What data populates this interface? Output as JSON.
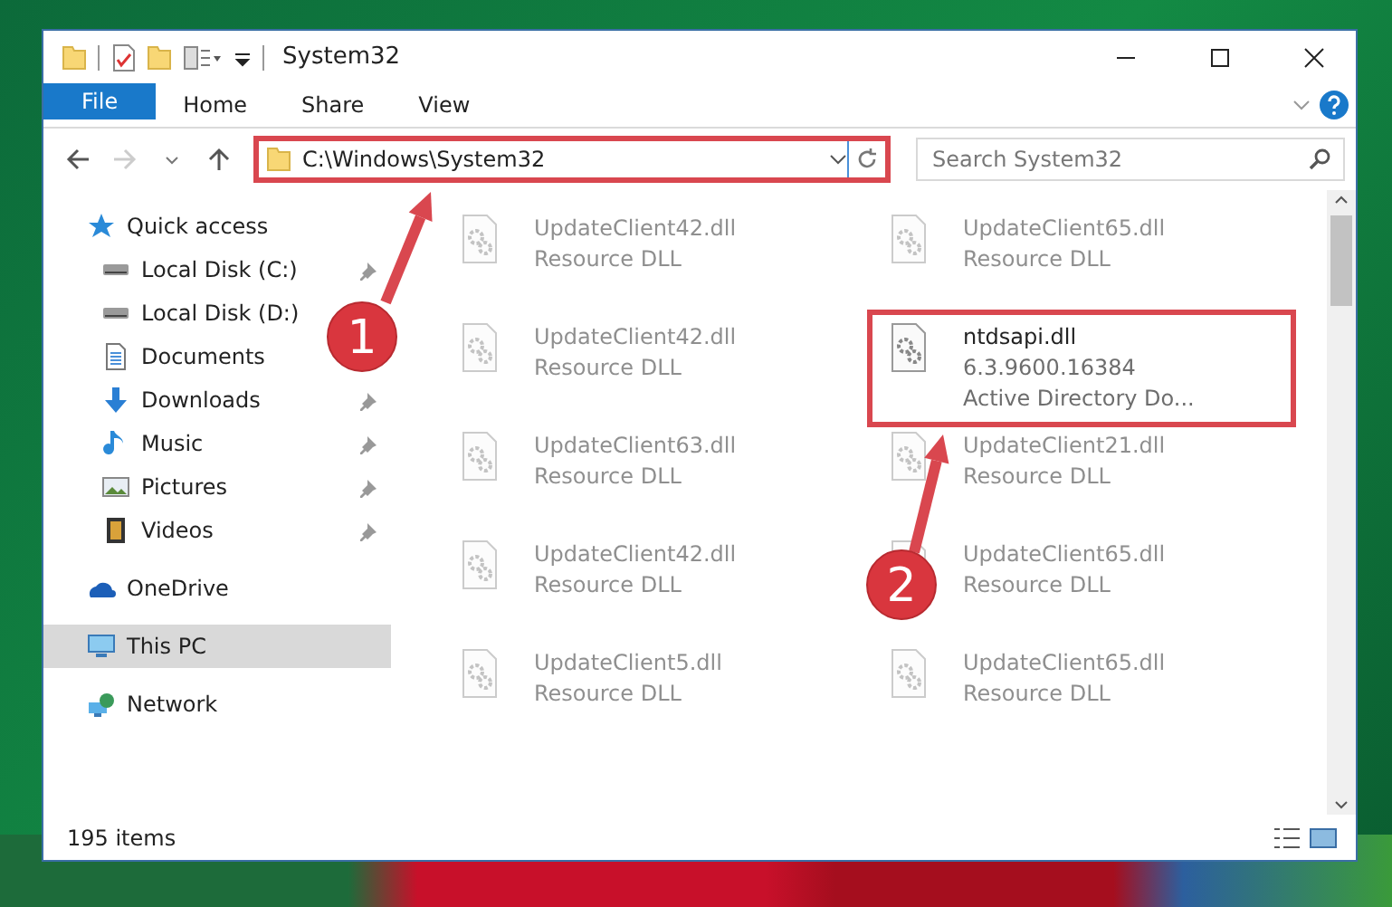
{
  "window": {
    "title": "System32"
  },
  "ribbon_tabs": [
    {
      "label": "File",
      "kind": "file"
    },
    {
      "label": "Home",
      "kind": "tab"
    },
    {
      "label": "Share",
      "kind": "tab"
    },
    {
      "label": "View",
      "kind": "tab"
    }
  ],
  "address": {
    "path": "C:\\Windows\\System32",
    "highlighted": true
  },
  "search": {
    "placeholder": "Search System32"
  },
  "sidebar": {
    "items": [
      {
        "label": "Quick access",
        "kind": "star",
        "selected": false,
        "children": [
          {
            "label": "Local Disk (C:)",
            "kind": "drive",
            "pinned": true
          },
          {
            "label": "Local Disk (D:)",
            "kind": "drive"
          },
          {
            "label": "Documents",
            "kind": "documents"
          },
          {
            "label": "Downloads",
            "kind": "downloads",
            "pinned": true
          },
          {
            "label": "Music",
            "kind": "music",
            "pinned": true
          },
          {
            "label": "Pictures",
            "kind": "pictures",
            "pinned": true
          },
          {
            "label": "Videos",
            "kind": "videos",
            "pinned": true
          }
        ]
      },
      {
        "label": "OneDrive",
        "kind": "cloud",
        "selected": false
      },
      {
        "label": "This PC",
        "kind": "pc",
        "selected": true
      },
      {
        "label": "Network",
        "kind": "network",
        "selected": false
      }
    ]
  },
  "files": [
    {
      "name": "UpdateClient42.dll",
      "lines": [
        "Resource DLL"
      ],
      "blurred": true,
      "highlighted": false
    },
    {
      "name": "UpdateClient65.dll",
      "lines": [
        "Resource DLL"
      ],
      "blurred": true,
      "highlighted": false
    },
    {
      "name": "UpdateClient42.dll",
      "lines": [
        "Resource DLL"
      ],
      "blurred": true,
      "highlighted": false
    },
    {
      "name": "ntdsapi.dll",
      "lines": [
        "6.3.9600.16384",
        "Active Directory Do..."
      ],
      "blurred": false,
      "highlighted": true
    },
    {
      "name": "UpdateClient63.dll",
      "lines": [
        "Resource DLL"
      ],
      "blurred": true,
      "highlighted": false
    },
    {
      "name": "UpdateClient21.dll",
      "lines": [
        "Resource DLL"
      ],
      "blurred": true,
      "highlighted": false
    },
    {
      "name": "UpdateClient42.dll",
      "lines": [
        "Resource DLL"
      ],
      "blurred": true,
      "highlighted": false
    },
    {
      "name": "UpdateClient65.dll",
      "lines": [
        "Resource DLL"
      ],
      "blurred": true,
      "highlighted": false
    },
    {
      "name": "UpdateClient5.dll",
      "lines": [
        "Resource DLL"
      ],
      "blurred": true,
      "highlighted": false
    },
    {
      "name": "UpdateClient65.dll",
      "lines": [
        "Resource DLL"
      ],
      "blurred": true,
      "highlighted": false
    }
  ],
  "status_bar": {
    "item_count": "195 items"
  },
  "annotations": [
    {
      "number": "1"
    },
    {
      "number": "2"
    }
  ]
}
